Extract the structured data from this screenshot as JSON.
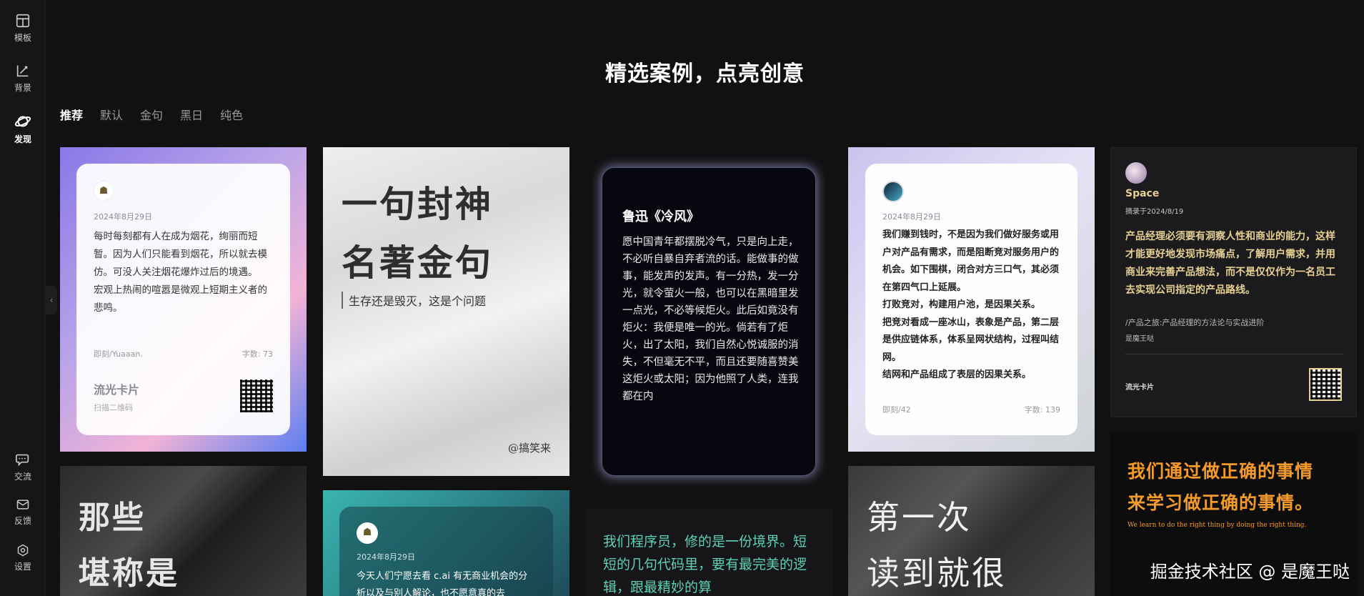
{
  "sidebar": {
    "items": [
      {
        "label": "模板"
      },
      {
        "label": "背景"
      },
      {
        "label": "发现"
      },
      {
        "label": "交流"
      },
      {
        "label": "反馈"
      },
      {
        "label": "设置"
      }
    ]
  },
  "page": {
    "title": "精选案例，点亮创意",
    "tabs": [
      "推荐",
      "默认",
      "金句",
      "黑日",
      "纯色"
    ],
    "active_tab": "推荐"
  },
  "cards": {
    "c1": {
      "date": "2024年8月29日",
      "text": "每时每刻都有人在成为烟花，绚丽而短暂。因为人们只能看到烟花，所以就去模仿。可没人关注烟花爆炸过后的境遇。\n宏观上热闹的喧嚣是微观上短期主义者的悲鸣。",
      "author": "即刻/Yuaaan.",
      "count": "字数: 73",
      "brand": "流光卡片",
      "scan": "扫描二维码"
    },
    "c2": {
      "line1": "一句封神",
      "line2": "名著金句",
      "quote": "生存还是毁灭，这是个问题",
      "handle": "@搞笑来"
    },
    "c3": {
      "title": "鲁迅《冷风》",
      "text": "愿中国青年都摆脱冷气，只是向上走，不必听自暴自弃者流的话。能做事的做事，能发声的发声。有一分热，发一分光，就令萤火一般，也可以在黑暗里发一点光，不必等候炬火。此后如竟没有炬火：我便是唯一的光。倘若有了炬火，出了太阳，我们自然心悦诚服的消失，不但毫无不平，而且还要随喜赞美这炬火或太阳；因为他照了人类，连我都在内"
    },
    "c4": {
      "date": "2024年8月29日",
      "text": "我们赚到钱时，不是因为我们做好服务或用户对产品有需求，而是阻断竞对服务用户的机会。如下围棋，闭合对方三口气，其必须在第四气口上延展。\n打败竞对，构建用户池，是因果关系。\n把竞对看成一座冰山，表象是产品，第二层是供应链体系，体系呈网状结构，过程叫结网。\n结网和产品组成了表层的因果关系。",
      "author": "即刻/42",
      "count": "字数: 139"
    },
    "c5": {
      "name": "Space",
      "date": "摘录于2024/8/19",
      "text": "产品经理必须要有洞察人性和商业的能力，这样才能更好地发现市场痛点，了解用户需求，并用商业来完善产品想法，而不是仅仅作为一名员工去实现公司指定的产品路线。",
      "source": "/产品之旅:产品经理的方法论与实战进阶",
      "author": "是魔王哒",
      "brand": "流光卡片"
    },
    "c6": {
      "line1": "那些",
      "line2": "堪称是"
    },
    "c7": {
      "date": "2024年8月29日",
      "text": "今天人们宁愿去看 c.ai 有无商业机会的分析以及与别人解论，也不愿意真的去"
    },
    "c8": {
      "text": "我们程序员，修的是一份境界。短短的几句代码里，要有最完美的逻辑，跟最精妙的算"
    },
    "c9": {
      "line1": "第一次",
      "line2": "读到就很"
    },
    "c10": {
      "line1": "我们通过做正确的事情",
      "line2": "来学习做正确的事情。",
      "en": "We learn to do the right thing by doing the right thing."
    }
  },
  "watermark": "掘金技术社区 @ 是魔王哒",
  "colors": {
    "accent_orange": "#f39a2b",
    "teal_text": "#5fd1b3",
    "gold_text": "#e6cf93"
  }
}
